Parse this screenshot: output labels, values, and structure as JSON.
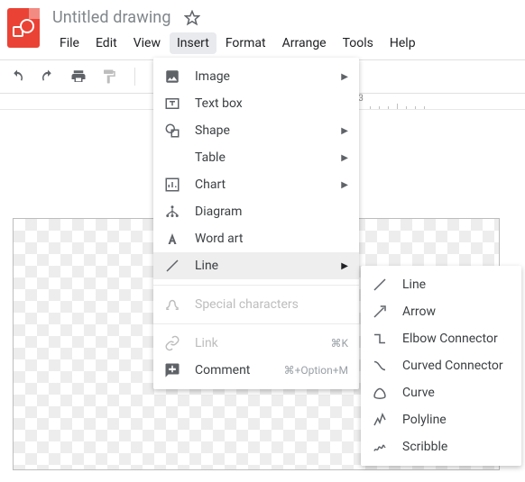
{
  "docTitle": "Untitled drawing",
  "menubar": [
    "File",
    "Edit",
    "View",
    "Insert",
    "Format",
    "Arrange",
    "Tools",
    "Help"
  ],
  "menubarActive": "Insert",
  "insertMenu": {
    "image": "Image",
    "textbox": "Text box",
    "shape": "Shape",
    "table": "Table",
    "chart": "Chart",
    "diagram": "Diagram",
    "wordart": "Word art",
    "line": "Line",
    "specialchars": "Special characters",
    "link": "Link",
    "linkShortcut": "⌘K",
    "comment": "Comment",
    "commentShortcut": "⌘+Option+M"
  },
  "lineSubmenu": {
    "line": "Line",
    "arrow": "Arrow",
    "elbow": "Elbow Connector",
    "curved": "Curved Connector",
    "curve": "Curve",
    "polyline": "Polyline",
    "scribble": "Scribble"
  },
  "ruler": {
    "mark3": "3"
  }
}
